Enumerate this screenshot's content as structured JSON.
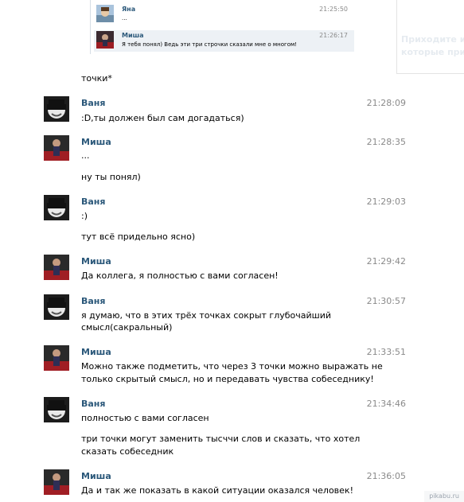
{
  "forwarded": [
    {
      "name": "Яна",
      "text": "...",
      "time": "21:25:50"
    },
    {
      "name": "Миша",
      "text": "Я тебя понял) Ведь эти три строчки сказали мне о многом!",
      "time": "21:26:17"
    }
  ],
  "side_box": {
    "line1": "Приходите и",
    "line2": "которые при"
  },
  "continuation": "точки*",
  "messages": [
    {
      "name": "Ваня",
      "time": "21:28:09",
      "lines": [
        ":D,ты должен был сам догадаться)"
      ]
    },
    {
      "name": "Миша",
      "time": "21:28:35",
      "lines": [
        "...",
        "",
        "ну ты понял)"
      ]
    },
    {
      "name": "Ваня",
      "time": "21:29:03",
      "lines": [
        ":)",
        "",
        "тут всё придельно ясно)"
      ]
    },
    {
      "name": "Миша",
      "time": "21:29:42",
      "lines": [
        "Да коллега, я полностью с вами согласен!"
      ]
    },
    {
      "name": "Ваня",
      "time": "21:30:57",
      "lines": [
        "я думаю, что в этих трёх точках сокрыт глубочайший",
        "смысл(сакральный)"
      ]
    },
    {
      "name": "Миша",
      "time": "21:33:51",
      "lines": [
        "Можно также подметить, что через 3 точки можно выражать не",
        "только скрытый смысл, но и передавать чувства собеседнику!"
      ]
    },
    {
      "name": "Ваня",
      "time": "21:34:46",
      "lines": [
        "полностью с вами согласен",
        "",
        "три точки могут заменить тысччи слов и сказать, что хотел",
        "сказать собеседник"
      ]
    },
    {
      "name": "Миша",
      "time": "21:36:05",
      "lines": [
        "Да и так же показать в какой ситуации оказался человек!"
      ]
    }
  ],
  "watermark": "pikabu.ru",
  "colors": {
    "name": "#2b587a",
    "time": "#8a8a8a",
    "fwd_bg": "#edf1f5"
  }
}
